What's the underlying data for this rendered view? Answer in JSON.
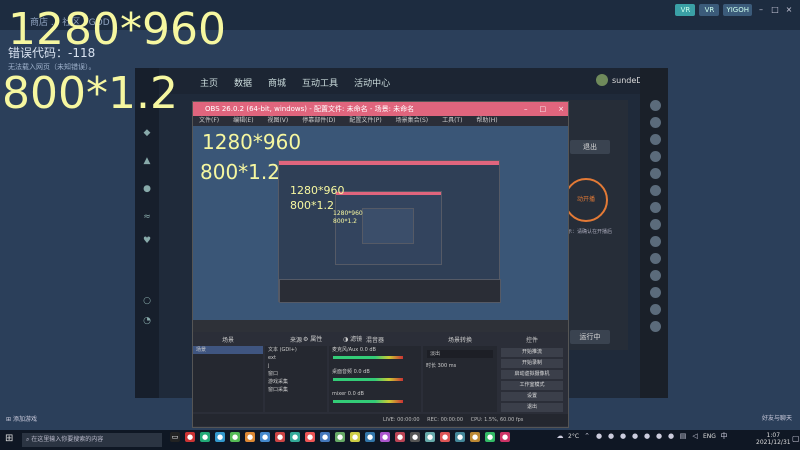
{
  "overlay": {
    "big_res": "1280*960",
    "big_scale": "800*1.2",
    "mid_res": "1280*960",
    "mid_scale": "800*1.2",
    "small_res": "1280*960",
    "small_scale": "800*1.2",
    "tiny_res": "1280*960",
    "tiny_scale": "800*1.2"
  },
  "desktop": {
    "menu_text": "商店  ... 社区 YGOD",
    "error_title": "错误代码：-118",
    "error_sub": "无法载入网页（未知错误）。",
    "top_right_labels": [
      "VR",
      "VR",
      "YIGOH"
    ],
    "add_source": "添加游戏",
    "right_bottom": "好友与聊天"
  },
  "companion": {
    "tabs": [
      "主页",
      "数据",
      "商城",
      "互动工具",
      "活动中心"
    ],
    "user": "sundeDe...",
    "side_buttons": [
      "退出",
      "动开播",
      "运行中"
    ],
    "hint": "提示：请确认在开播后"
  },
  "obs": {
    "title": "OBS 26.0.2 (64-bit, windows) - 配置文件: 未命名 - 场景: 未命名",
    "menu": [
      "文件(F)",
      "编辑(E)",
      "视图(V)",
      "停靠部件(D)",
      "配置文件(P)",
      "场景集合(S)",
      "工具(T)",
      "帮助(H)"
    ],
    "controls": [
      "–",
      "□",
      "×"
    ],
    "filters_label": "属性",
    "scenes_label": "滤镜",
    "docks": {
      "scenes": {
        "title": "场景",
        "items": [
          "场景"
        ]
      },
      "sources": {
        "title": "来源",
        "items": [
          "文本 (GDI+)",
          "ext",
          "j",
          "窗口",
          "游戏采集",
          "窗口采集"
        ]
      },
      "mixer": {
        "title": "混音器",
        "items": [
          "麦克风/Aux",
          "桌面音频",
          "mixer"
        ],
        "levels": [
          "0.0 dB",
          "0.0 dB",
          "0.0 dB"
        ]
      },
      "transitions": {
        "title": "场景转换",
        "mode": "淡出",
        "duration_label": "时长",
        "duration": "300 ms"
      },
      "controls": {
        "title": "控件",
        "buttons": [
          "开始推流",
          "开始录制",
          "启动虚拟摄像机",
          "工作室模式",
          "设置",
          "退出"
        ]
      }
    },
    "status": [
      "LIVE: 00:00:00",
      "REC: 00:00:00",
      "CPU: 1.5%, 60.00 fps"
    ]
  },
  "taskbar": {
    "search_placeholder": "在这里输入你要搜索的内容",
    "temp": "2°C",
    "lang": "ENG",
    "time": "1:07",
    "date": "2021/12/31"
  }
}
